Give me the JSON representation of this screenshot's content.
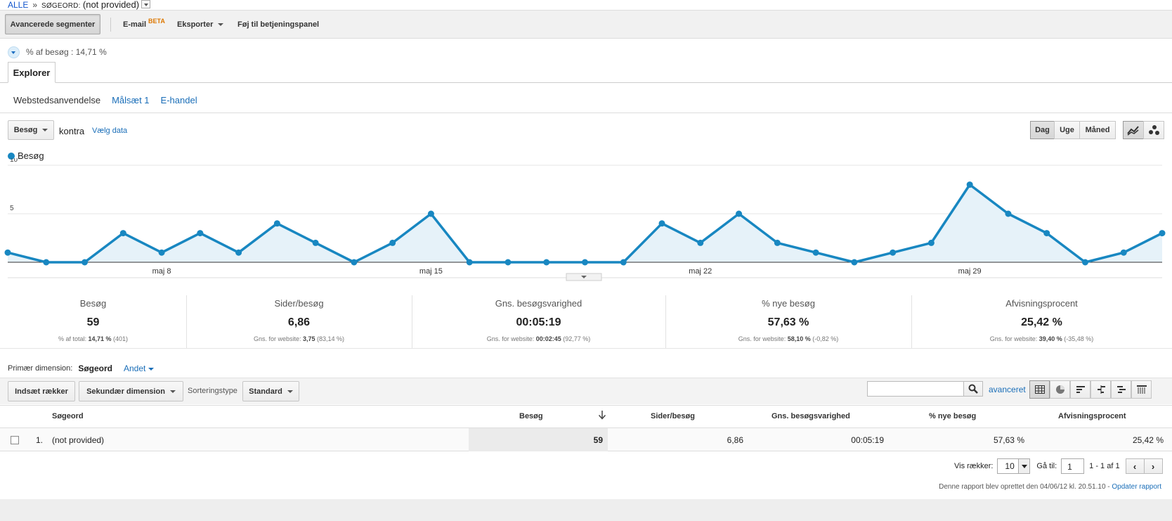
{
  "breadcrumb": {
    "root": "ALLE",
    "separator": "»",
    "dimension_label": "SØGEORD:",
    "dimension_value": "(not provided)"
  },
  "toolbar": {
    "advanced_segments": "Avancerede segmenter",
    "email": "E-mail",
    "email_badge": "BETA",
    "export": "Eksporter",
    "add_to_dashboard": "Føj til betjeningspanel"
  },
  "segment": {
    "label": "% af besøg : 14,71 %"
  },
  "tabs": {
    "explorer": "Explorer"
  },
  "subtabs": [
    {
      "label": "Webstedsanvendelse",
      "active": true
    },
    {
      "label": "Målsæt 1",
      "active": false
    },
    {
      "label": "E-handel",
      "active": false
    }
  ],
  "chart_controls": {
    "metric": "Besøg",
    "vs": "kontra",
    "choose_data": "Vælg data",
    "granularity": [
      "Dag",
      "Uge",
      "Måned"
    ],
    "selected_granularity": "Dag"
  },
  "chart_data": {
    "type": "area",
    "series": [
      {
        "name": "Besøg",
        "values": [
          1,
          0,
          0,
          3,
          1,
          3,
          1,
          4,
          2,
          0,
          2,
          5,
          0,
          0,
          0,
          0,
          0,
          4,
          2,
          5,
          2,
          1,
          0,
          1,
          2,
          8,
          5,
          3,
          0,
          1,
          3
        ]
      }
    ],
    "x_tick_labels": [
      "maj 8",
      "maj 15",
      "maj 22",
      "maj 29"
    ],
    "x_tick_indices": [
      4,
      11,
      18,
      25
    ],
    "y_ticks": [
      10,
      5
    ],
    "ylim": [
      0,
      10
    ],
    "color": "#1887c1",
    "legend": "top-left"
  },
  "scorecards": [
    {
      "title": "Besøg",
      "value": "59",
      "sub_prefix": "% af total: ",
      "sub_bold": "14,71 %",
      "sub_suffix": " (401)"
    },
    {
      "title": "Sider/besøg",
      "value": "6,86",
      "sub_prefix": "Gns. for website: ",
      "sub_bold": "3,75",
      "sub_suffix": " (83,14 %)"
    },
    {
      "title": "Gns. besøgsvarighed",
      "value": "00:05:19",
      "sub_prefix": "Gns. for website: ",
      "sub_bold": "00:02:45",
      "sub_suffix": " (92,77 %)"
    },
    {
      "title": "% nye besøg",
      "value": "57,63 %",
      "sub_prefix": "Gns. for website: ",
      "sub_bold": "58,10 %",
      "sub_suffix": " (-0,82 %)"
    },
    {
      "title": "Afvisningsprocent",
      "value": "25,42 %",
      "sub_prefix": "Gns. for website: ",
      "sub_bold": "39,40 %",
      "sub_suffix": " (-35,48 %)"
    }
  ],
  "dimension": {
    "label": "Primær dimension:",
    "current": "Søgeord",
    "other": "Andet"
  },
  "table_toolbar": {
    "insert_rows": "Indsæt rækker",
    "secondary_dimension": "Sekundær dimension",
    "sort_type_label": "Sorteringstype",
    "sort_type": "Standard",
    "advanced": "avanceret",
    "search_value": ""
  },
  "table": {
    "headers": [
      "Søgeord",
      "Besøg",
      "Sider/besøg",
      "Gns. besøgsvarighed",
      "% nye besøg",
      "Afvisningsprocent"
    ],
    "rows": [
      {
        "index": "1.",
        "keyword": "(not provided)",
        "visits": "59",
        "pages": "6,86",
        "duration": "00:05:19",
        "new": "57,63 %",
        "bounce": "25,42 %"
      }
    ]
  },
  "pagination": {
    "rows_label": "Vis rækker:",
    "rows_value": "10",
    "goto_label": "Gå til:",
    "goto_value": "1",
    "range": "1 - 1 af 1"
  },
  "footer": {
    "note": "Denne rapport blev oprettet den 04/06/12 kl. 20.51.10 - ",
    "refresh": "Opdater rapport"
  }
}
